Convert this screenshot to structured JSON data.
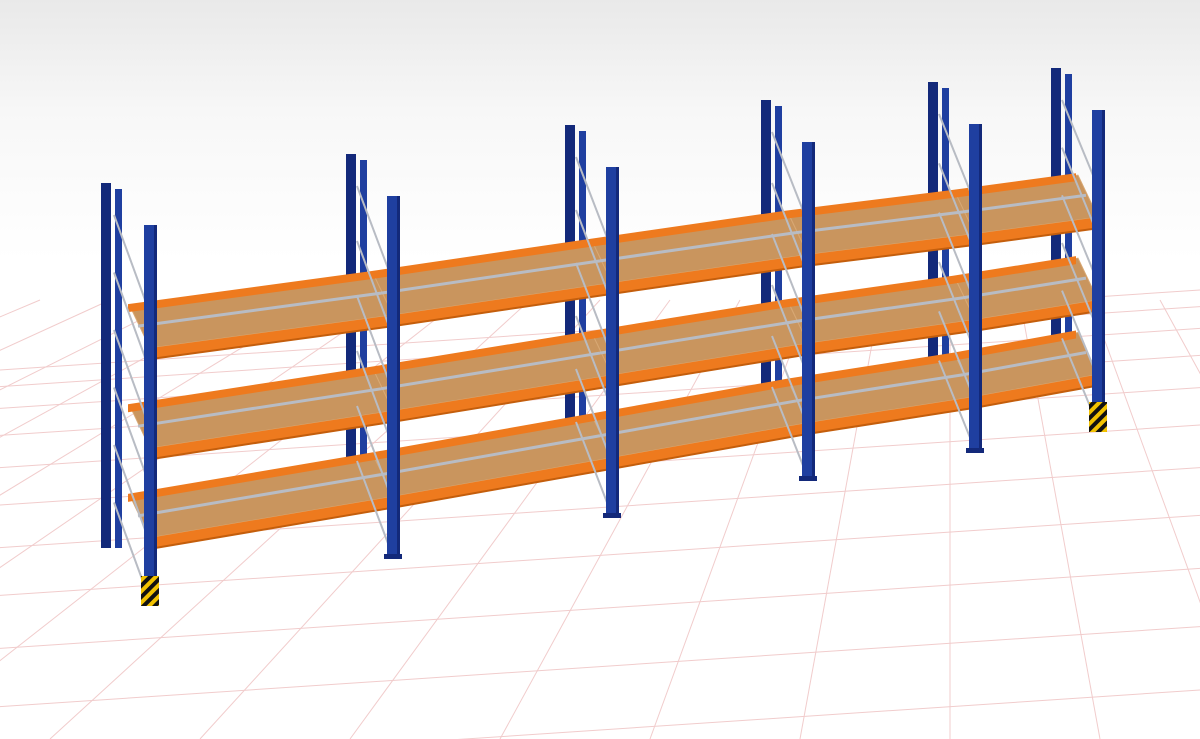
{
  "scene": {
    "description_visible_text": "",
    "colors": {
      "upright_blue": "#1f3fa0",
      "upright_blue_dark": "#13297a",
      "beam_orange": "#ee7a1e",
      "beam_orange_dark": "#c45e0c",
      "deck_board": "#c9955e",
      "deck_board_light": "#d8a874",
      "bracing_grey": "#b8bcc4",
      "grid_line": "#f1cccc",
      "floor": "#ffffff",
      "hazard_yellow": "#f2c200",
      "hazard_black": "#111111"
    },
    "rack": {
      "bays": 5,
      "levels": 3,
      "deck_material": "chipboard",
      "frame_style": "pallet-rack"
    }
  }
}
